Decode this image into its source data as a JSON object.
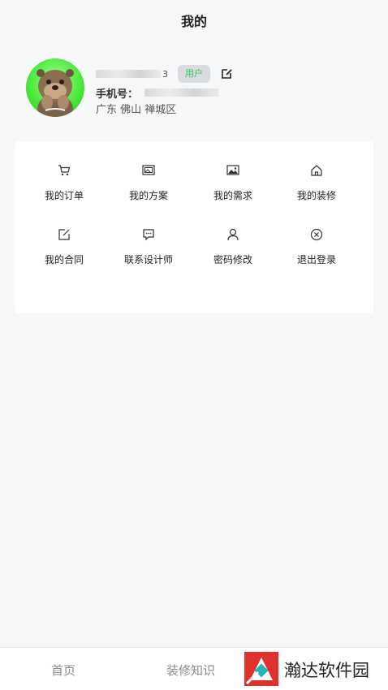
{
  "header": {
    "title": "我的"
  },
  "profile": {
    "name_tail": "3",
    "role_badge": "用户",
    "phone_label": "手机号：",
    "location": "广东 佛山 禅城区"
  },
  "menu": {
    "items": [
      {
        "label": "我的订单",
        "icon": "cart-icon"
      },
      {
        "label": "我的方案",
        "icon": "gallery-icon"
      },
      {
        "label": "我的需求",
        "icon": "image-icon"
      },
      {
        "label": "我的装修",
        "icon": "home-icon"
      },
      {
        "label": "我的合同",
        "icon": "edit-icon"
      },
      {
        "label": "联系设计师",
        "icon": "chat-icon"
      },
      {
        "label": "密码修改",
        "icon": "user-icon"
      },
      {
        "label": "退出登录",
        "icon": "close-circle-icon"
      }
    ]
  },
  "tabbar": {
    "home": "首页",
    "knowledge": "装修知识"
  },
  "watermark": {
    "text": "瀚达软件园"
  },
  "colors": {
    "background": "#f6f7f9",
    "badge_text": "#34c759",
    "badge_bg": "#d8dbe0",
    "avatar_green": "#4eea3c",
    "watermark_red": "#e0312c"
  }
}
